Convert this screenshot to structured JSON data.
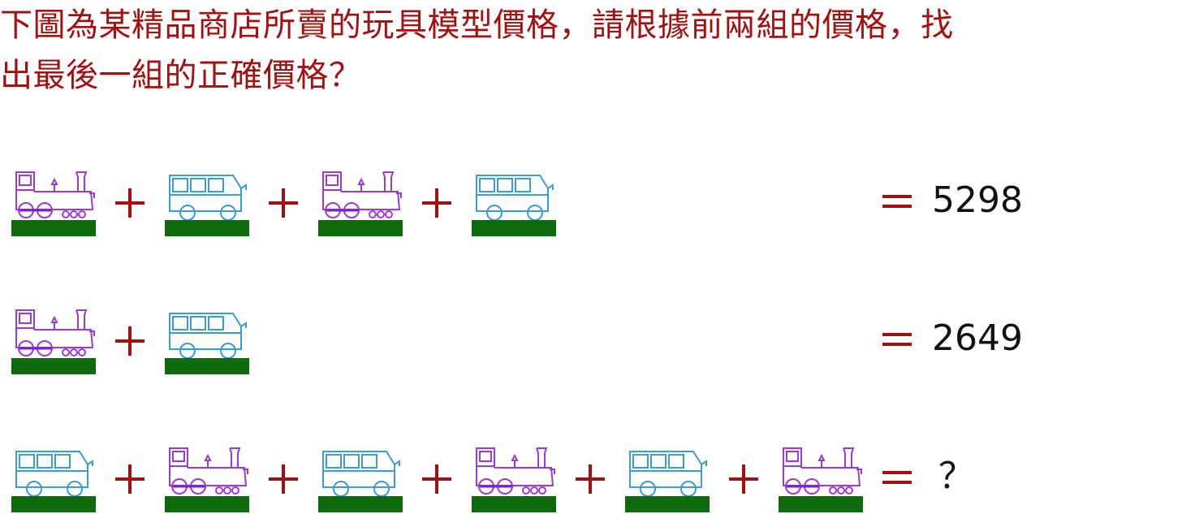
{
  "question": {
    "line1": "下圖為某精品商店所賣的玩具模型價格，請根據前兩組的價格，找",
    "line2": "出最後一組的正確價格？"
  },
  "icons": {
    "train": "train-icon",
    "bus": "bus-icon",
    "plus": "plus-sign",
    "equals": "equals-sign"
  },
  "colors": {
    "question_text": "#a31010",
    "operator": "#a31010",
    "train": "#9b3bd6",
    "wheel_rod": "#7b1fd0",
    "bus": "#3b9bd6",
    "ground": "#0d6b0d",
    "result_text": "#111111"
  },
  "equations": [
    {
      "items": [
        "train",
        "bus",
        "train",
        "bus"
      ],
      "result": "5298"
    },
    {
      "items": [
        "train",
        "bus"
      ],
      "result": "2649"
    },
    {
      "items": [
        "bus",
        "train",
        "bus",
        "train",
        "bus",
        "train"
      ],
      "result": "？"
    }
  ]
}
